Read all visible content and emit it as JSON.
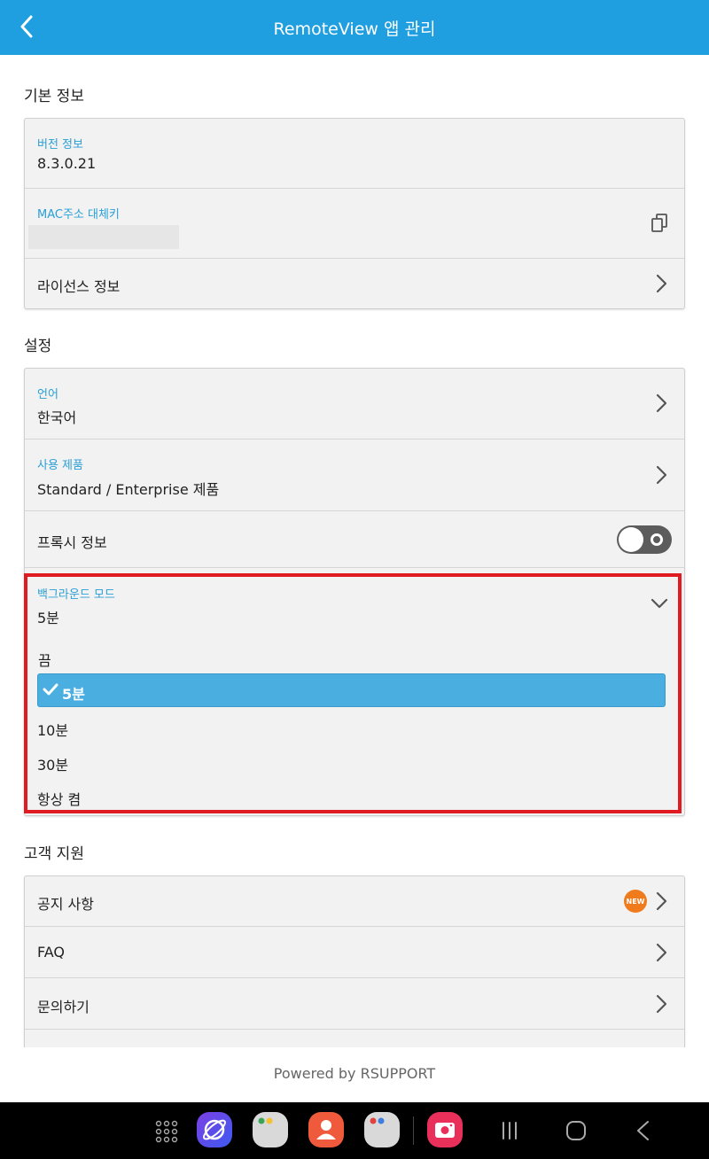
{
  "appbar": {
    "title": "RemoteView 앱 관리"
  },
  "basic_info": {
    "section_title": "기본 정보",
    "version_label": "버전 정보",
    "version_value": "8.3.0.21",
    "mac_label": "MAC주소 대체키",
    "license_label": "라이선스 정보"
  },
  "settings": {
    "section_title": "설정",
    "language_label": "언어",
    "language_value": "한국어",
    "product_label": "사용 제품",
    "product_value": "Standard / Enterprise 제품",
    "proxy_label": "프록시 정보",
    "background_label": "백그라운드 모드",
    "background_value": "5분",
    "options": [
      "끔",
      "5분",
      "10분",
      "30분",
      "항상 켬"
    ],
    "selected_option": "5분"
  },
  "support": {
    "section_title": "고객 지원",
    "notice_label": "공지 사항",
    "new_badge": "NEW",
    "faq_label": "FAQ",
    "inquiry_label": "문의하기"
  },
  "footer": {
    "powered": "Powered by RSUPPORT"
  },
  "colors": {
    "appbar": "#1f9fdf",
    "accent_label": "#2a9fd6",
    "selected_option_bg": "#4aafe0",
    "highlight_border": "#e11b22",
    "new_badge": "#f07b1c"
  }
}
